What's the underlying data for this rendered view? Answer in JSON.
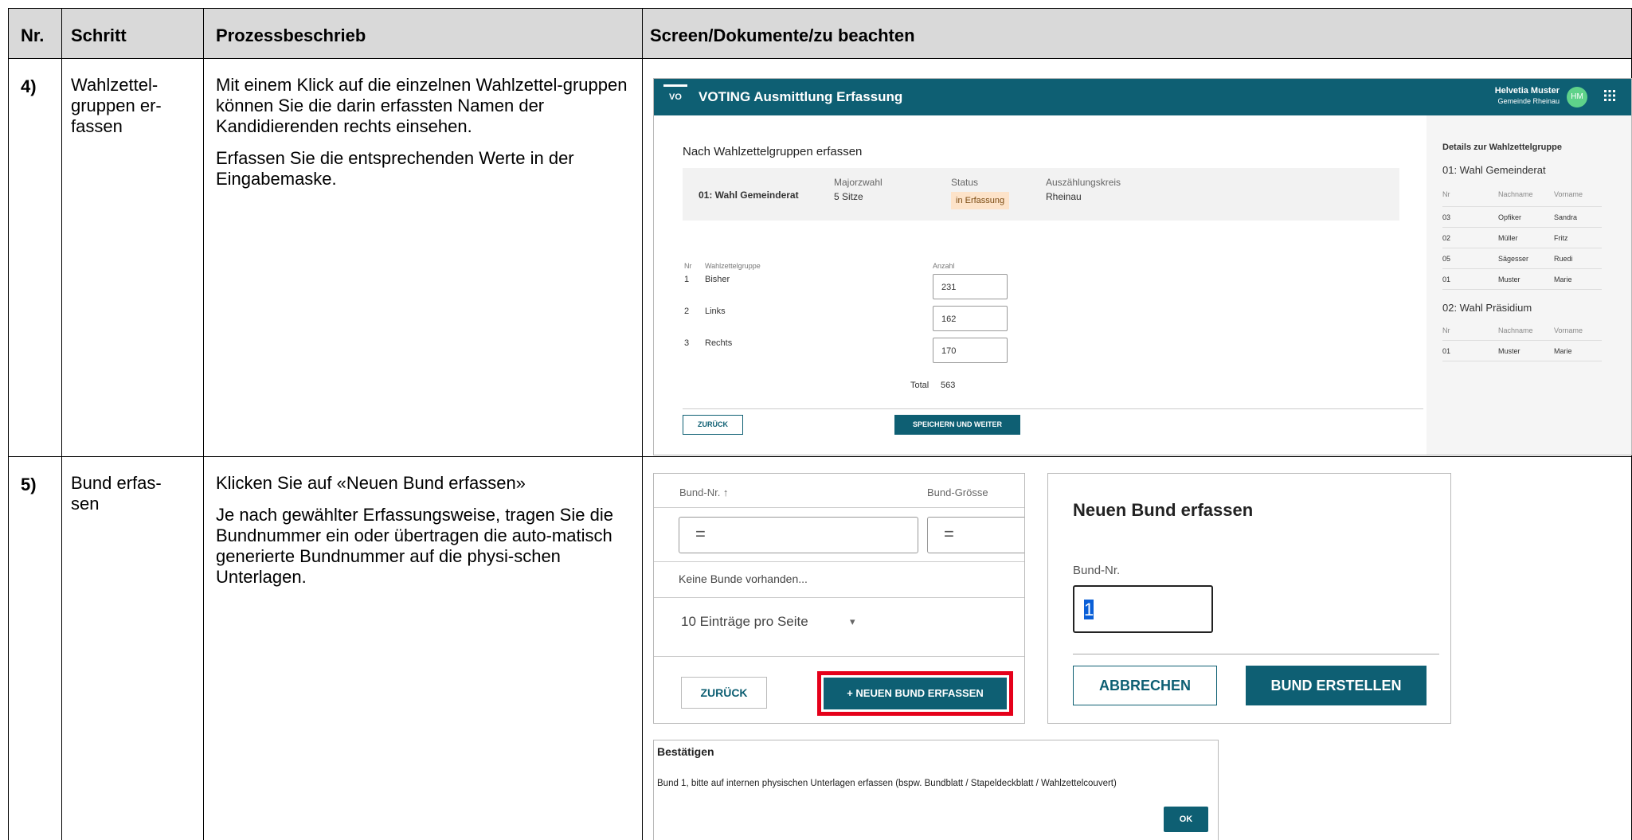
{
  "table": {
    "headers": {
      "nr": "Nr.",
      "schritt": "Schritt",
      "prozess": "Prozessbeschrieb",
      "screen": "Screen/Dokumente/zu beachten"
    },
    "rows": [
      {
        "nr": "4)",
        "schritt": [
          "Wahlzettel-",
          "gruppen er-",
          "fassen"
        ],
        "prozess": [
          "Mit einem Klick auf die einzelnen Wahlzettel-gruppen können Sie die darin erfassten Namen der Kandidierenden rechts einsehen.",
          "Erfassen Sie die entsprechenden Werte in der Eingabemaske."
        ]
      },
      {
        "nr": "5)",
        "schritt": [
          "Bund erfas-",
          "sen"
        ],
        "prozess": [
          "Klicken Sie auf «Neuen Bund erfassen»",
          "Je nach gewählter Erfassungsweise, tragen Sie die Bundnummer ein oder übertragen die auto-matisch generierte Bundnummer auf die physi-schen Unterlagen."
        ]
      }
    ]
  },
  "voting_app": {
    "logo": "VO",
    "title": "VOTING Ausmittlung Erfassung",
    "user_name": "Helvetia Muster",
    "user_sub": "Gemeinde Rheinau",
    "avatar": "HM",
    "grid_icon": "apps-grid-icon",
    "close_glyph": "✕",
    "heading": "Nach Wahlzettelgruppen erfassen",
    "info": {
      "name": "01: Wahl Gemeinderat",
      "type_label": "Majorzwahl",
      "type_value": "5 Sitze",
      "status_label": "Status",
      "status_value": "in Erfassung",
      "kreis_label": "Auszählungskreis",
      "kreis_value": "Rheinau"
    },
    "columns": {
      "nr": "Nr",
      "gruppe": "Wahlzettelgruppe",
      "anzahl": "Anzahl"
    },
    "rows": [
      {
        "nr": "1",
        "name": "Bisher",
        "value": "231"
      },
      {
        "nr": "2",
        "name": "Links",
        "value": "162"
      },
      {
        "nr": "3",
        "name": "Rechts",
        "value": "170"
      }
    ],
    "total_label": "Total",
    "total_value": "563",
    "back": "ZURÜCK",
    "save": "SPEICHERN UND WEITER",
    "side": {
      "title": "Details zur Wahlzettelgruppe",
      "group1": "01: Wahl Gemeinderat",
      "columns": {
        "nr": "Nr",
        "nachname": "Nachname",
        "vorname": "Vorname"
      },
      "rows1": [
        {
          "nr": "03",
          "nachname": "Opfiker",
          "vorname": "Sandra"
        },
        {
          "nr": "02",
          "nachname": "Müller",
          "vorname": "Fritz"
        },
        {
          "nr": "05",
          "nachname": "Sägesser",
          "vorname": "Ruedi"
        },
        {
          "nr": "01",
          "nachname": "Muster",
          "vorname": "Marie"
        }
      ],
      "group2": "02: Wahl Präsidium",
      "rows2": [
        {
          "nr": "01",
          "nachname": "Muster",
          "vorname": "Marie"
        }
      ]
    }
  },
  "bund_list": {
    "col1": "Bund-Nr. ↑",
    "col2": "Bund-Grösse",
    "filter_symbol": "=",
    "empty": "Keine Bunde vorhanden...",
    "page_size": "10 Einträge pro Seite",
    "back": "ZURÜCK",
    "new": "+ NEUEN BUND ERFASSEN",
    "highlight_color": "#e5001a"
  },
  "bund_dialog": {
    "title": "Neuen Bund erfassen",
    "label": "Bund-Nr.",
    "value": "1",
    "cancel": "ABBRECHEN",
    "create": "BUND ERSTELLEN"
  },
  "confirm": {
    "title": "Bestätigen",
    "message": "Bund 1, bitte auf internen physischen Unterlagen erfassen (bspw. Bundblatt / Stapeldeckblatt / Wahlzettelcouvert)",
    "ok": "OK"
  },
  "colors": {
    "primary": "#0e5f73",
    "header_bg": "#d9d9d9",
    "status_bg": "#fde3c9",
    "avatar": "#5fd28a"
  }
}
